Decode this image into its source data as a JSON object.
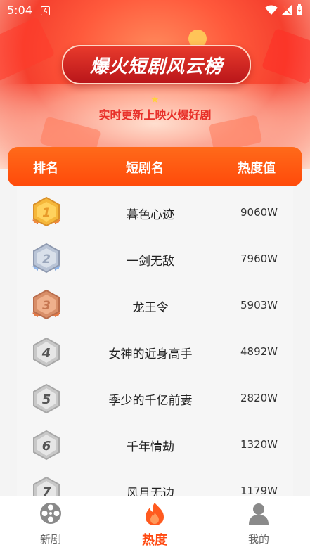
{
  "status_bar": {
    "time": "5:04",
    "app_icon": "A"
  },
  "hero": {
    "title": "爆火短剧风云榜",
    "subtitle": "实时更新上映火爆好剧"
  },
  "table": {
    "headers": {
      "rank": "排名",
      "name": "短剧名",
      "heat": "热度值"
    },
    "rows": [
      {
        "rank": "1",
        "name": "暮色心迹",
        "heat": "9060W"
      },
      {
        "rank": "2",
        "name": "一剑无敌",
        "heat": "7960W"
      },
      {
        "rank": "3",
        "name": "龙王令",
        "heat": "5903W"
      },
      {
        "rank": "4",
        "name": "女神的近身高手",
        "heat": "4892W"
      },
      {
        "rank": "5",
        "name": "季少的千亿前妻",
        "heat": "2820W"
      },
      {
        "rank": "6",
        "name": "千年情劫",
        "heat": "1320W"
      },
      {
        "rank": "7",
        "name": "风月无边",
        "heat": "1179W"
      }
    ]
  },
  "tabs": [
    {
      "label": "新剧",
      "icon": "film-reel-icon"
    },
    {
      "label": "热度",
      "icon": "flame-icon",
      "active": true
    },
    {
      "label": "我的",
      "icon": "user-icon"
    }
  ],
  "colors": {
    "accent": "#ff4a12",
    "header": "#ff5a14",
    "title_red": "#e8302a"
  }
}
